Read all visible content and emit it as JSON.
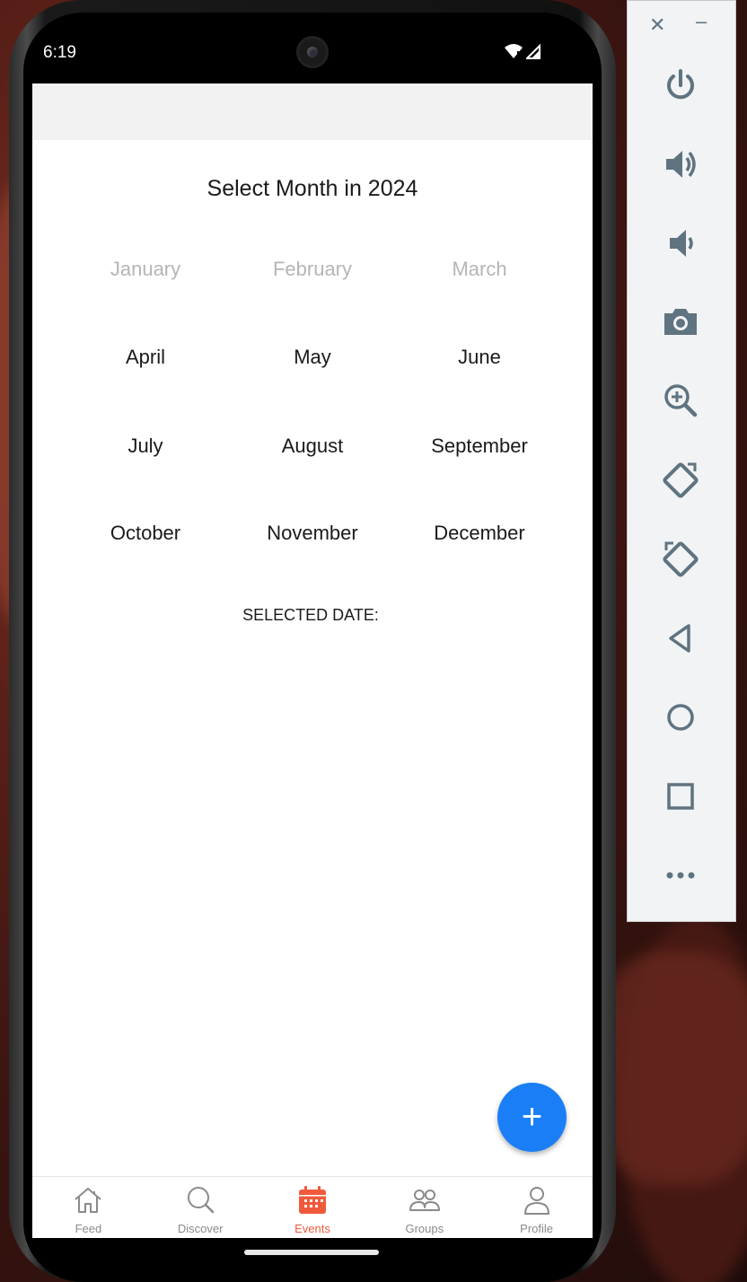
{
  "status": {
    "time": "6:19"
  },
  "calendar": {
    "title": "Select Month in 2024",
    "months": [
      {
        "label": "January",
        "disabled": true
      },
      {
        "label": "February",
        "disabled": true
      },
      {
        "label": "March",
        "disabled": true
      },
      {
        "label": "April",
        "disabled": false
      },
      {
        "label": "May",
        "disabled": false
      },
      {
        "label": "June",
        "disabled": false
      },
      {
        "label": "July",
        "disabled": false
      },
      {
        "label": "August",
        "disabled": false
      },
      {
        "label": "September",
        "disabled": false
      },
      {
        "label": "October",
        "disabled": false
      },
      {
        "label": "November",
        "disabled": false
      },
      {
        "label": "December",
        "disabled": false
      }
    ],
    "selected_date_label": "SELECTED DATE:"
  },
  "fab": {
    "label": "+",
    "color": "#1a7ff7"
  },
  "nav": {
    "items": [
      {
        "label": "Feed",
        "icon": "home-icon",
        "active": false
      },
      {
        "label": "Discover",
        "icon": "search-icon",
        "active": false
      },
      {
        "label": "Events",
        "icon": "calendar-icon",
        "active": true
      },
      {
        "label": "Groups",
        "icon": "groups-icon",
        "active": false
      },
      {
        "label": "Profile",
        "icon": "person-icon",
        "active": false
      }
    ],
    "active_color": "#f05a3c"
  },
  "toolbar": {
    "close_label": "✕",
    "minimize_label": "–",
    "buttons": [
      "power-icon",
      "volume-up-icon",
      "volume-down-icon",
      "camera-icon",
      "zoom-icon",
      "rotate-left-icon",
      "rotate-right-icon",
      "back-icon",
      "home-circle-icon",
      "overview-icon",
      "more-icon"
    ]
  }
}
